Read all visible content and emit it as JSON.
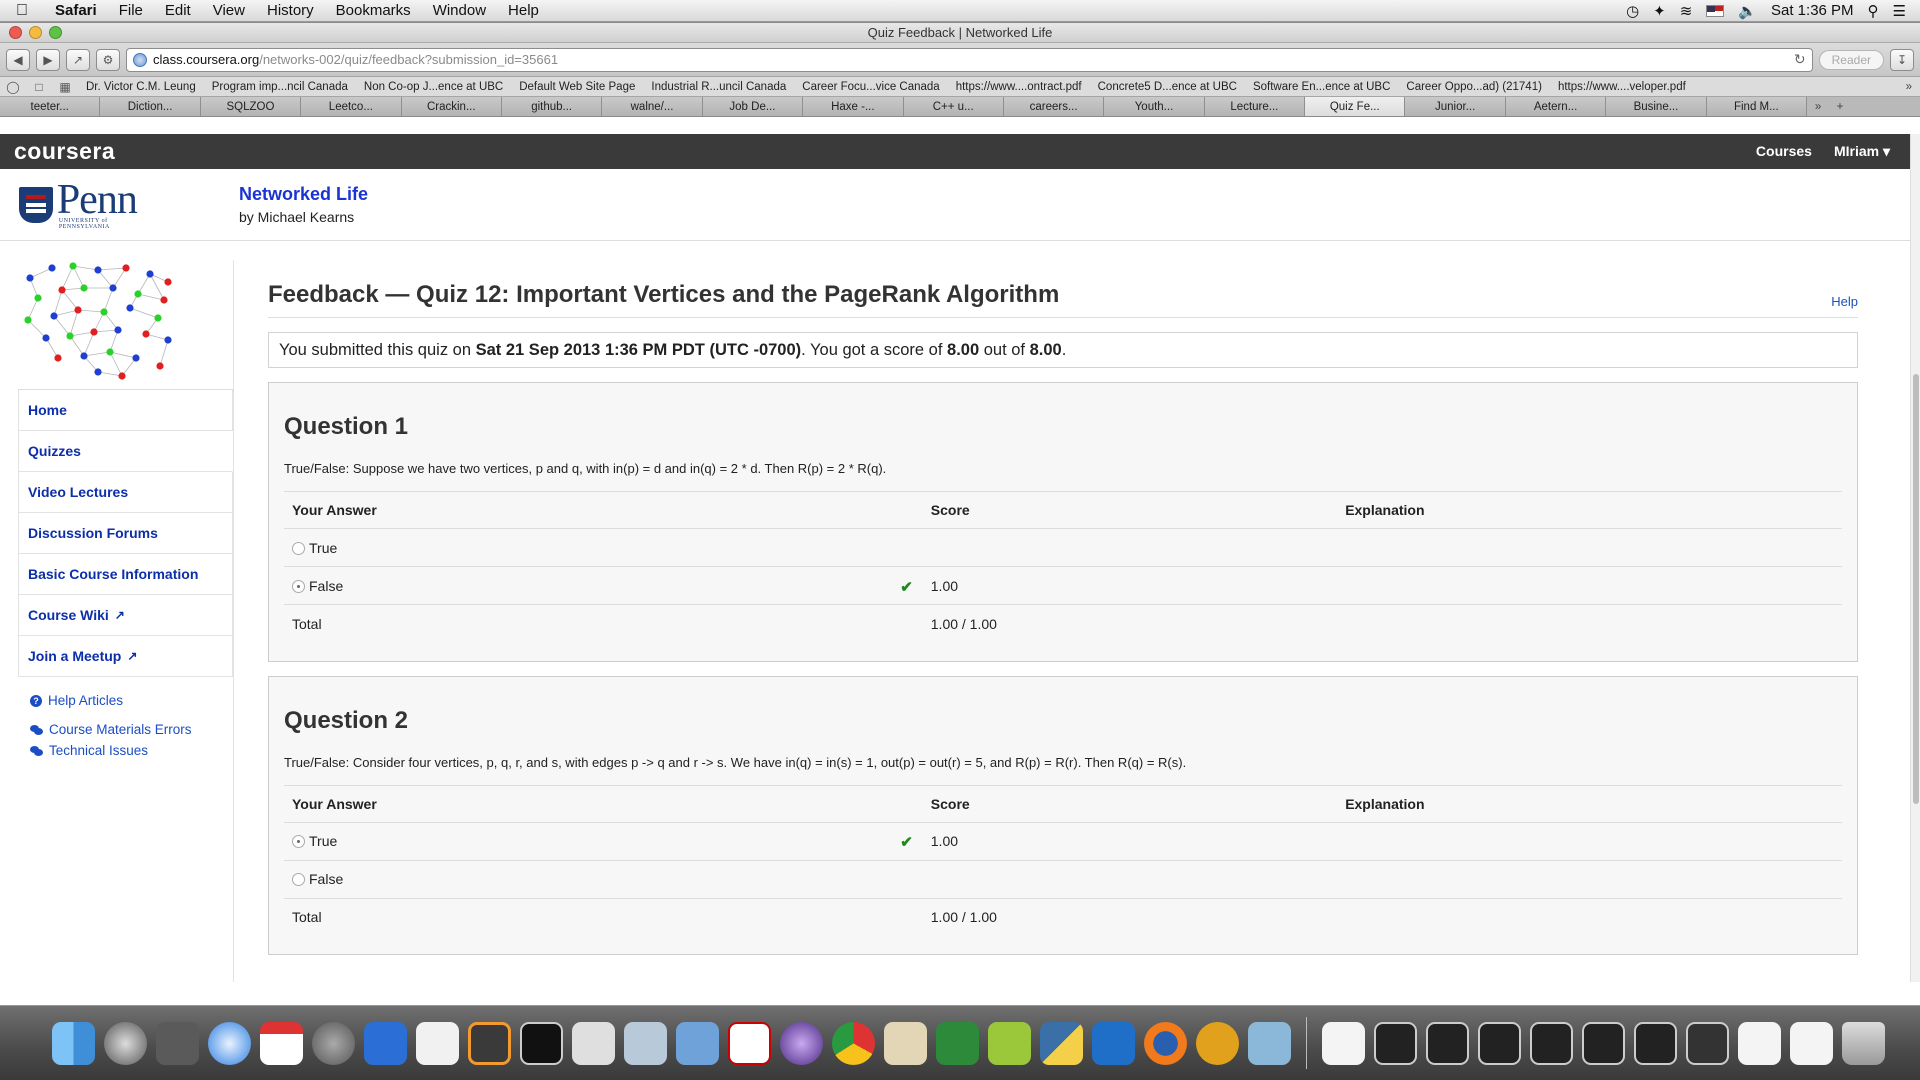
{
  "menubar": {
    "app": "Safari",
    "items": [
      "File",
      "Edit",
      "View",
      "History",
      "Bookmarks",
      "Window",
      "Help"
    ],
    "clock": "Sat 1:36 PM"
  },
  "window": {
    "title": "Quiz Feedback | Networked Life"
  },
  "toolbar": {
    "url_host": "class.coursera.org",
    "url_path": "/networks-002/quiz/feedback?submission_id=35661",
    "reader": "Reader"
  },
  "bookmarks": [
    "Dr. Victor C.M. Leung",
    "Program imp...ncil Canada",
    "Non Co-op J...ence at UBC",
    "Default Web Site Page",
    "Industrial R...uncil Canada",
    "Career Focu...vice Canada",
    "https://www....ontract.pdf",
    "Concrete5 D...ence at UBC",
    "Software En...ence at UBC",
    "Career Oppo...ad) (21741)",
    "https://www....veloper.pdf"
  ],
  "tabs": [
    "teeter...",
    "Diction...",
    "SQLZOO",
    "Leetco...",
    "Crackin...",
    "github...",
    "walne/...",
    "Job De...",
    "Haxe -...",
    "C++ u...",
    "careers...",
    "Youth...",
    "Lecture...",
    "Quiz Fe...",
    "Junior...",
    "Aetern...",
    "Busine...",
    "Find M..."
  ],
  "active_tab": 13,
  "coursera": {
    "logo": "coursera",
    "nav_courses": "Courses",
    "nav_user": "MIriam ▾"
  },
  "course": {
    "penn": "Penn",
    "penn_sub": "UNIVERSITY of PENNSYLVANIA",
    "name": "Networked Life",
    "by": "by Michael Kearns"
  },
  "sidebar": {
    "items": [
      "Home",
      "Quizzes",
      "Video Lectures",
      "Discussion Forums",
      "Basic Course Information",
      "Course Wiki",
      "Join a Meetup"
    ],
    "links": [
      "Help Articles",
      "Course Materials Errors",
      "Technical Issues"
    ]
  },
  "main": {
    "title": "Feedback — Quiz 12: Important Vertices and the PageRank Algorithm",
    "help": "Help",
    "submit_pre": "You submitted this quiz on ",
    "submit_date": "Sat 21 Sep 2013 1:36 PM PDT (UTC -0700)",
    "submit_mid": ". You got a score of ",
    "score": "8.00",
    "submit_of": " out of ",
    "max": "8.00",
    "submit_end": "."
  },
  "table_headers": {
    "answer": "Your Answer",
    "score": "Score",
    "explanation": "Explanation"
  },
  "questions": [
    {
      "title": "Question 1",
      "text": "True/False: Suppose we have two vertices, p and q, with in(p) = d and in(q) = 2 * d. Then R(p) = 2 * R(q).",
      "rows": [
        {
          "answer": "True",
          "score": ""
        },
        {
          "answer": "False",
          "score": "1.00"
        }
      ],
      "total_label": "Total",
      "total": "1.00 / 1.00"
    },
    {
      "title": "Question 2",
      "text": "True/False: Consider four vertices, p, q, r, and s, with edges p -> q and r -> s. We have in(q) = in(s) = 1, out(p) = out(r) = 5, and R(p) = R(r). Then R(q) = R(s).",
      "rows": [
        {
          "answer": "True",
          "score": "1.00"
        },
        {
          "answer": "False",
          "score": ""
        }
      ],
      "total_label": "Total",
      "total": "1.00 / 1.00"
    }
  ],
  "colors": {
    "link": "#0c2ea8",
    "course_title": "#1a33d4",
    "coursera_bar": "#3a3a3a",
    "check": "#1e8a1e"
  }
}
